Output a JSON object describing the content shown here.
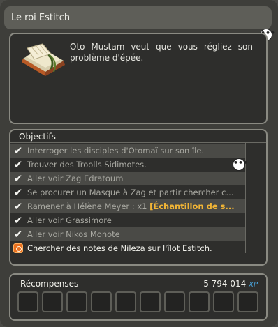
{
  "window": {
    "title": "Le roi Estitch"
  },
  "description": {
    "text": "Oto Mustam veut que vous régliez son problème d'épée."
  },
  "objectives": {
    "header": "Objectifs",
    "items": [
      {
        "text": "Interroger les disciples d'Otomaï sur son île.",
        "status": "done"
      },
      {
        "text": "Trouver des Troolls Sidimotes.",
        "status": "done"
      },
      {
        "text": "Aller voir Zag Edratoum",
        "status": "done"
      },
      {
        "text": "Se procurer un Masque à Zag et partir chercher c...",
        "status": "done"
      },
      {
        "text_prefix": "Ramener à Hélène Meyer : x1 ",
        "text_highlight": "[Échantillon de s...",
        "status": "done"
      },
      {
        "text": "Aller voir Grassimore",
        "status": "done"
      },
      {
        "text": "Aller voir Nikos Monote",
        "status": "done"
      },
      {
        "text": "Chercher des notes de Nileza sur l'îlot Estitch.",
        "status": "active"
      }
    ]
  },
  "rewards": {
    "label": "Récompenses",
    "xp_value": "5 794 014",
    "xp_unit": "XP",
    "slot_count": 10
  },
  "icons": {
    "bubble": "speech-bubble-icon",
    "check": "checkmark-icon",
    "target": "target-icon",
    "quest": "quest-book-icon"
  },
  "colors": {
    "highlight": "#f0b436",
    "xp": "#4aa6e0",
    "target": "#e9701f"
  }
}
